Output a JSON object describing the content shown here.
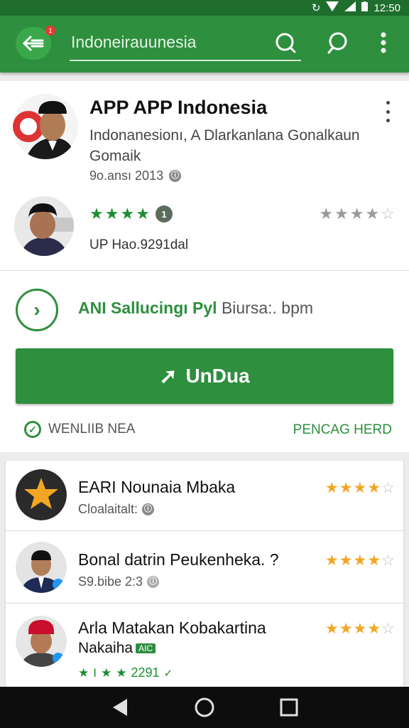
{
  "status_bar": {
    "time": "12:50"
  },
  "app_bar": {
    "search_text": "Indoneirauunesia",
    "notification_count": "1"
  },
  "app": {
    "title": "APP APP Indonesia",
    "subtitle": "Indonanesionı, A Dlarkanlana Gonalkaun Gomaik",
    "date": "9o.ansı 2013",
    "rating_badge": "1",
    "update_text": "UP Hao.9291dal"
  },
  "feature": {
    "text_green": "ANI Sallucingı Pyl",
    "text_gray": "Biursa:. bpm"
  },
  "install_button": {
    "label": "UnDua"
  },
  "verified": {
    "label": "WENLIIB NEA"
  },
  "more_link": {
    "label": "PENCAG HERD"
  },
  "list": [
    {
      "title": "EARI Nounaia Mbaka",
      "sub": "Cloalaitalt:"
    },
    {
      "title": "Bonal datrin Peukenheka.  ?",
      "sub": "S9.bibe 2:3"
    },
    {
      "title": "Arla Matakan Kobakartina",
      "title2": "Nakaiha",
      "badge": "AIC",
      "sub": "2291"
    }
  ],
  "colors": {
    "primary": "#2e8f3e",
    "star_gold": "#f2a623",
    "star_green": "#1e8e2f"
  }
}
